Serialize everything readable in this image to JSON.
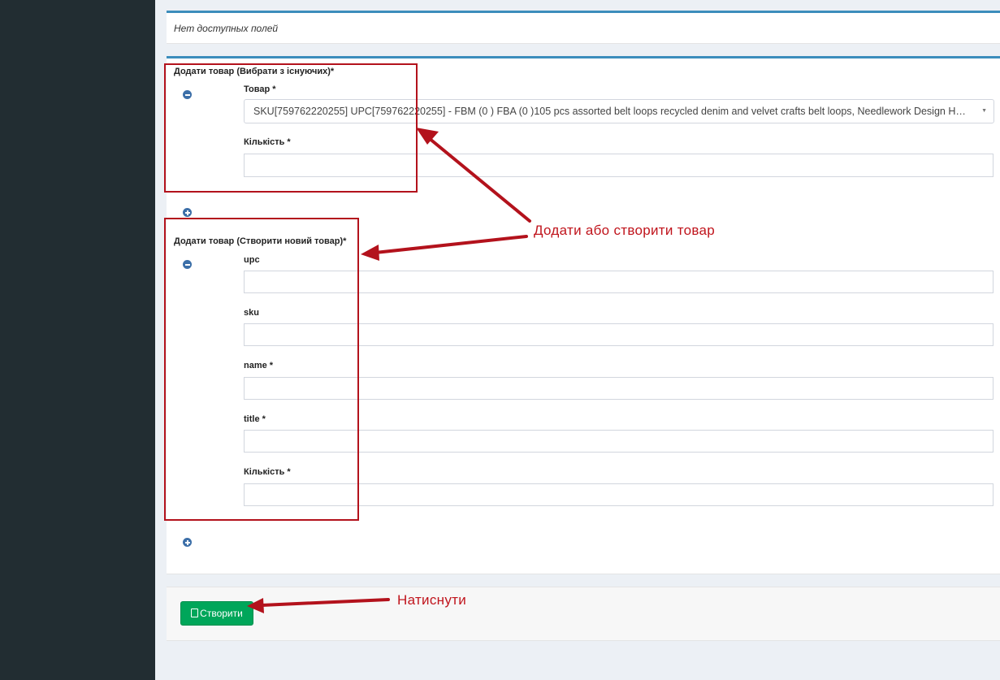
{
  "top_box": {
    "empty_text": "Нет доступных полей"
  },
  "existing_section": {
    "title": "Додати товар (Вибрати з існуючих)*",
    "product_label": "Товар *",
    "product_value": "SKU[759762220255] UPC[759762220255] - FBM (0 ) FBA (0 )105 pcs assorted belt loops recycled denim and velvet crafts belt loops, Needlework Design Handmade Craft",
    "quantity_label": "Кількість *"
  },
  "new_section": {
    "title": "Додати товар (Створити новий товар)*",
    "fields": [
      {
        "label": "upc"
      },
      {
        "label": "sku"
      },
      {
        "label": "name *"
      },
      {
        "label": "title *"
      },
      {
        "label": "Кількість *"
      }
    ]
  },
  "footer": {
    "create_label": "Створити"
  },
  "annotations": {
    "add_or_create": "Додати або створити товар",
    "press": "Натиснути"
  },
  "colors": {
    "accent": "#3c8dbc",
    "sidebar": "#222d32",
    "success": "#00a65a",
    "annotation": "#c0141c"
  }
}
